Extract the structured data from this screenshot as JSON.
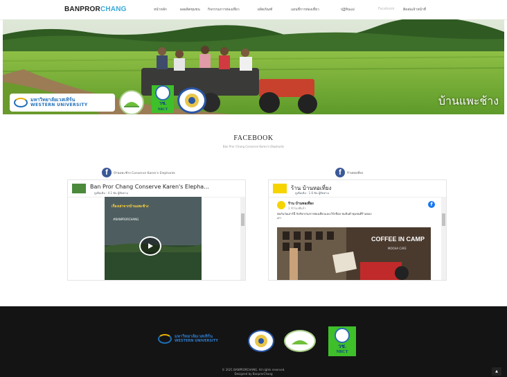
{
  "nav": {
    "brand_part1": "BANPROR",
    "brand_part2": "CHANG",
    "menu": [
      "หน้าหลัก",
      "ผลผลิตชุมชน",
      "กิจกรรมการท่องเที่ยว",
      "ผลิตภัณฑ์",
      "แผนที่การท่องเที่ยว",
      "ปฏิทินแม่",
      "Facebook",
      "ติดต่อเจ้าหน้าที่"
    ],
    "active_index": 6
  },
  "hero": {
    "title": "บ้านแพะช้าง",
    "logo_msu_line1": "มหาวิทยาลัยเวสเทิร์น",
    "logo_msu_line2": "WESTERN UNIVERSITY",
    "nrct_label": "วช.",
    "nrct_sub": "NRCT"
  },
  "facebook": {
    "title": "FACEBOOK",
    "subtitle": "Ban Pror Chang Conserve Karen's Elephants",
    "left": {
      "header": "บ้านแพะช้าง Conserve Karen's Elephants",
      "page_name": "Ban Pror Chang Conserve Karen's Elepha...",
      "meta": "ดูเพิ่มเติม · 4.1 พัน ผู้ติดตาม",
      "video_caption": "เรื่องเล่าจากบ้านแพะช้าง",
      "video_tag": "#BANPRORCHANG"
    },
    "right": {
      "header": "ร้านหอเที่ยง",
      "page_name": "ร้าน บ้านหอเที่ยง",
      "meta": "ดูเพิ่มเติม · 1.6 พัน ผู้ติดตาม",
      "post_author": "ร้าน บ้านหอเที่ยง",
      "post_time": "1 ชั่วโมงที่แล้ว",
      "post_text": "พบกันวันเสาร์นี้ กับกิจกรรมการท่องเที่ยวและเวิร์กช็อป ชมสินค้าชุมชนที่ร้านของเรา",
      "photo_sign": "COFFEE IN CAMP",
      "photo_sub": "MOCHA CAFE"
    }
  },
  "footer": {
    "nrct_label": "วช.",
    "nrct_sub": "NRCT",
    "copyright": "© 2021 BANPRORCHANG. All rights reserved.",
    "credit": "Designed by BanprorChang"
  },
  "colors": {
    "brand_accent": "#3aa8d8",
    "facebook": "#3b5998",
    "nrct_green": "#3fbf2a",
    "footer_bg": "#141414"
  }
}
